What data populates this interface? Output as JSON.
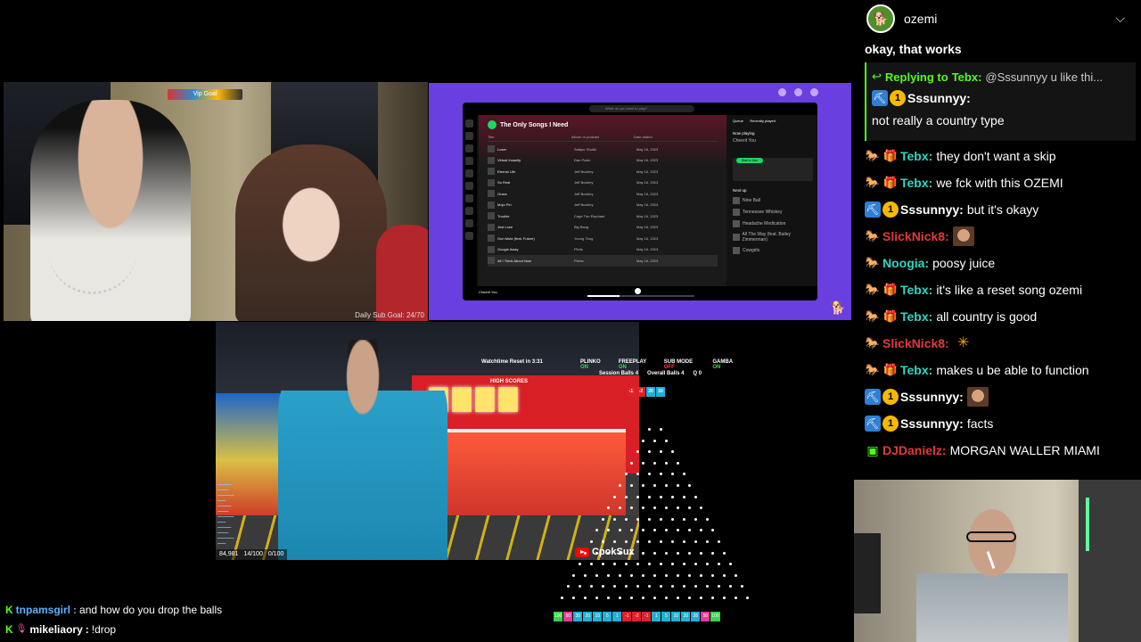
{
  "top_left_cam": {
    "overlay_badge": "Vip Goal",
    "daily_goal": "Daily Sub Goal: 24/70"
  },
  "spotify": {
    "search_placeholder": "What do you want to play?",
    "playlist_title": "The Only Songs I Need",
    "headers": [
      "Title",
      "Album or podcast",
      "Date added"
    ],
    "tracks": [
      {
        "title": "Loser",
        "album": "Saltpur Studio",
        "date": "May 16, 2023"
      },
      {
        "title": "Virtual Insanity",
        "album": "Dan Pusic",
        "date": "May 16, 2023"
      },
      {
        "title": "Eternal Life",
        "album": "Jeff Buckley",
        "date": "May 16, 2023"
      },
      {
        "title": "So Real",
        "album": "Jeff Buckley",
        "date": "May 16, 2023"
      },
      {
        "title": "Grace",
        "album": "Jeff Buckley",
        "date": "May 16, 2023"
      },
      {
        "title": "Mojo Pin",
        "album": "Jeff Buckley",
        "date": "May 16, 2023"
      },
      {
        "title": "Trouble",
        "album": "Cage The Elephant",
        "date": "May 16, 2023"
      },
      {
        "title": "Just Lose",
        "album": "Big Bang",
        "date": "May 16, 2023"
      },
      {
        "title": "Gun Mute (feat. Future)",
        "album": "Young Thug",
        "date": "May 16, 2023"
      },
      {
        "title": "Google Away",
        "album": "Pilots",
        "date": "May 16, 2023"
      },
      {
        "title": "All I Think About Now",
        "album": "Pixies",
        "date": "May 16, 2023"
      }
    ],
    "right_tabs": [
      "Queue",
      "Recently played"
    ],
    "now_playing_label": "Now playing",
    "now_playing_track": "Cheerit You",
    "jam_button": "Start a Jam",
    "next_up_label": "Next up",
    "next_up": [
      "Nine Ball",
      "Tennessee Whiskey",
      "Headache Medication",
      "All The Way (feat. Bailey Zimmerman)",
      "Cowgirls"
    ],
    "bottom_track": "Cheerit You"
  },
  "irl": {
    "watchtime": "Watchtime Reset in 3:31",
    "highscores": "HIGH SCORES",
    "stats": [
      "84,981",
      "14/100",
      "0/100"
    ],
    "youtube_channel": "CpokSux"
  },
  "hud": {
    "modes": [
      {
        "name": "PLINKO",
        "state": "ON"
      },
      {
        "name": "FREEPLAY",
        "state": "ON"
      },
      {
        "name": "SUB MODE",
        "state": "OFF"
      },
      {
        "name": "GAMBA",
        "state": "ON"
      }
    ],
    "session_balls_label": "Session Balls",
    "session_balls": "4",
    "overall_balls_label": "Overall Balls",
    "overall_balls": "4",
    "q_label": "Q",
    "q_value": "0",
    "ball_slots": [
      "-1",
      "-2",
      "20",
      "10"
    ],
    "bins": [
      "100",
      "50",
      "35",
      "20",
      "10",
      "5",
      "1",
      "-1",
      "-2",
      "-1",
      "1",
      "5",
      "10",
      "20",
      "35",
      "50",
      "100"
    ],
    "bin_colors": [
      "#39d24a",
      "#e83a9a",
      "#1fb0d8",
      "#1fb0d8",
      "#1fb0d8",
      "#1fb0d8",
      "#1fb0d8",
      "#e0202a",
      "#e0202a",
      "#e0202a",
      "#1fb0d8",
      "#1fb0d8",
      "#1fb0d8",
      "#1fb0d8",
      "#1fb0d8",
      "#e83a9a",
      "#39d24a"
    ]
  },
  "left_chat": [
    {
      "user": "tnpamsgirl",
      "text": "and how do you drop the balls",
      "color": "#5ab3ff"
    },
    {
      "user": "mikeliaory",
      "text": "!drop",
      "color": "#ffffff"
    }
  ],
  "right_chat": {
    "channel_user": "ozemi",
    "pinned_text": "okay, that works",
    "reply": {
      "prefix": "Replying to",
      "target": "Tebx:",
      "preview": "@Sssunnyy u like thi...",
      "user": "Sssunnyy:",
      "text": "not really a country type"
    },
    "messages": [
      {
        "user": "Tebx:",
        "color": "#2fd6c4",
        "text": "they don't want a skip",
        "badges": [
          "horse",
          "gift"
        ],
        "emote": ""
      },
      {
        "user": "Tebx:",
        "color": "#2fd6c4",
        "text": "we fck with this OZEMI",
        "badges": [
          "horse",
          "gift"
        ],
        "emote": ""
      },
      {
        "user": "Sssunnyy:",
        "color": "#ffffff",
        "text": "but it's okayy",
        "badges": [
          "pick",
          "one"
        ],
        "emote": ""
      },
      {
        "user": "SlickNick8:",
        "color": "#e03a3a",
        "text": "",
        "badges": [
          "horse"
        ],
        "emote": "face"
      },
      {
        "user": "Noogia:",
        "color": "#2fd6c4",
        "text": "poosy juice",
        "badges": [
          "horse"
        ],
        "emote": ""
      },
      {
        "user": "Tebx:",
        "color": "#2fd6c4",
        "text": "it's like a reset song ozemi",
        "badges": [
          "horse",
          "gift"
        ],
        "emote": ""
      },
      {
        "user": "Tebx:",
        "color": "#2fd6c4",
        "text": "all country is good",
        "badges": [
          "horse",
          "gift"
        ],
        "emote": ""
      },
      {
        "user": "SlickNick8:",
        "color": "#e03a3a",
        "text": "",
        "badges": [
          "horse"
        ],
        "emote": "burst"
      },
      {
        "user": "Tebx:",
        "color": "#2fd6c4",
        "text": "makes u be able to function",
        "badges": [
          "horse",
          "gift"
        ],
        "emote": ""
      },
      {
        "user": "Sssunnyy:",
        "color": "#ffffff",
        "text": "",
        "badges": [
          "pick",
          "one"
        ],
        "emote": "face"
      },
      {
        "user": "Sssunnyy:",
        "color": "#ffffff",
        "text": "facts",
        "badges": [
          "pick",
          "one"
        ],
        "emote": ""
      },
      {
        "user": "DJDanielz:",
        "color": "#e03a3a",
        "text": "MORGAN WALLER MIAMI",
        "badges": [
          "green"
        ],
        "emote": ""
      }
    ]
  }
}
